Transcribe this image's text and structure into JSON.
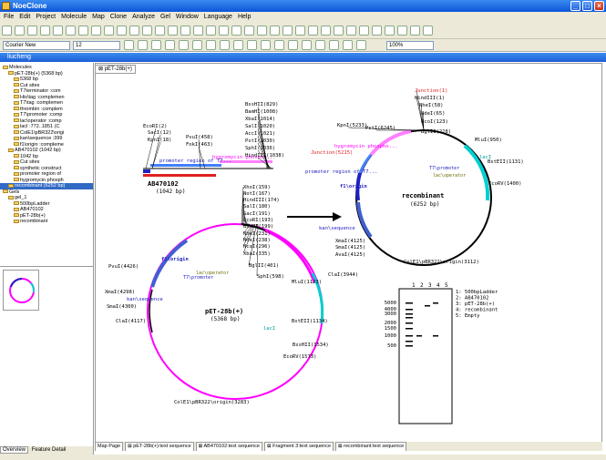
{
  "app": {
    "title": "NoeClone"
  },
  "menu": [
    "File",
    "Edit",
    "Project",
    "Molecule",
    "Map",
    "Clone",
    "Analyze",
    "Gel",
    "Window",
    "Language",
    "Help"
  ],
  "format": {
    "font": "Courier New",
    "size": "12",
    "zoom": "100%"
  },
  "doc_title": "liucheng",
  "tab_top": "pET-28b(+)",
  "tree": [
    {
      "t": "Molecules",
      "l": 1
    },
    {
      "t": "pET-28b(+) (5368 bp)",
      "l": 2
    },
    {
      "t": "5368 bp",
      "l": 3
    },
    {
      "t": "Cut sites",
      "l": 3
    },
    {
      "t": "T7terminator :com",
      "l": 3
    },
    {
      "t": "His\\tag :complemen",
      "l": 3
    },
    {
      "t": "T7\\tag :complemen",
      "l": 3
    },
    {
      "t": "thrombin :complem",
      "l": 3
    },
    {
      "t": "T7\\promoter :comp",
      "l": 3
    },
    {
      "t": "lac\\operator :comp",
      "l": 3
    },
    {
      "t": "lacI :772..1851 (C",
      "l": 3
    },
    {
      "t": "ColE1\\pBR322\\origi",
      "l": 3
    },
    {
      "t": "kan\\sequence :399",
      "l": 3
    },
    {
      "t": "f1\\origin :compleme",
      "l": 3
    },
    {
      "t": "AB470102 (1042 bp)",
      "l": 2
    },
    {
      "t": "1042 bp",
      "l": 3
    },
    {
      "t": "Cut sites",
      "l": 3
    },
    {
      "t": "synthetic construct",
      "l": 3
    },
    {
      "t": "promoter region of",
      "l": 3
    },
    {
      "t": "hygromycin phosph",
      "l": 3
    },
    {
      "t": "recombinant (6252 bp)",
      "l": 2
    },
    {
      "t": "Gels",
      "l": 1
    },
    {
      "t": "gel_1",
      "l": 2
    },
    {
      "t": "500bpLadder",
      "l": 3
    },
    {
      "t": "AB470102",
      "l": 3
    },
    {
      "t": "pET-28b(+)",
      "l": 3
    },
    {
      "t": "recombinant",
      "l": 3
    }
  ],
  "left_tabs": {
    "overview": "Overview",
    "feature": "Feature Detail"
  },
  "bottom_tabs": [
    "Map Page",
    "pET-28b(+):text sequence",
    "AB470102:text sequence",
    "Fragment 3:text sequence",
    "recombinant:text sequence"
  ],
  "colors": {
    "pink": "#ff00ff",
    "blue": "#2020c0",
    "cyan": "#00cfd0",
    "lightpink": "#ff80ff"
  },
  "maps": {
    "ab": {
      "name": "AB470102",
      "size": "(1042 bp)",
      "sites": [
        "EcoRI(2)",
        "SacI(12)",
        "KpnI(18)",
        "PvuI(458)",
        "FokI(463)",
        "BssHII(829)",
        "BamHI(1008)",
        "XbaI(1014)",
        "SalI(1020)",
        "AccI(1021)",
        "PstI(1030)",
        "SphI(1036)",
        "HindIII(1038)"
      ],
      "features": [
        "promoter region of T7...",
        "hygromycin phospho..."
      ]
    },
    "pet": {
      "name": "pET-28b(+)",
      "size": "(5368 bp)",
      "sites": [
        "XhoI(159)",
        "NotI(167)",
        "HindIII(174)",
        "SalI(180)",
        "SacI(191)",
        "EcoRI(193)",
        "BamHI(199)",
        "NheI(231)",
        "NdeI(238)",
        "NcoI(296)",
        "XbaI(335)",
        "BglII(401)",
        "SphI(598)",
        "PvuI(4426)",
        "XmaI(4298)",
        "SmaI(4300)",
        "ClaI(4117)",
        "MluI(1123)",
        "BstEII(1134)",
        "BssHII(1534)",
        "EcoRV(1573)",
        "ColE1\\pBR322\\origin(3283)"
      ],
      "features": [
        "f1\\origin",
        "kan\\sequence",
        "lac\\operator",
        "T7\\promoter",
        "lacI"
      ]
    },
    "rec": {
      "name": "recombinant",
      "size": "(6252 bp)",
      "sites": [
        "Junction(1)",
        "HindIII(1)",
        "NheI(58)",
        "NdeI(65)",
        "NcoI(123)",
        "BglII(228)",
        "MluI(950)",
        "BstEII(1131)",
        "EcoRV(1400)",
        "KpnI(5233)",
        "PstI(6245)",
        "Junction(5215)",
        "XmaI(4125)",
        "SmaI(4125)",
        "AvaI(4125)",
        "ClaI(3944)",
        "ColE1\\pBR322\\origin(3112)"
      ],
      "features": [
        "hygromycin phospho...",
        "promoter region of T7...",
        "f1\\origin",
        "kan\\sequence",
        "T7\\promoter",
        "lac\\operator",
        "lacI"
      ]
    }
  },
  "gel": {
    "lanes": [
      "1",
      "2",
      "3",
      "4",
      "5"
    ],
    "ladder": [
      "5000",
      "4000",
      "3000",
      "2000",
      "1500",
      "1000",
      "500"
    ],
    "legend": [
      "1: 500bpLadder",
      "2: AB470102",
      "3: pET-28b(+)",
      "4: recombinant",
      "5: Empty"
    ]
  }
}
